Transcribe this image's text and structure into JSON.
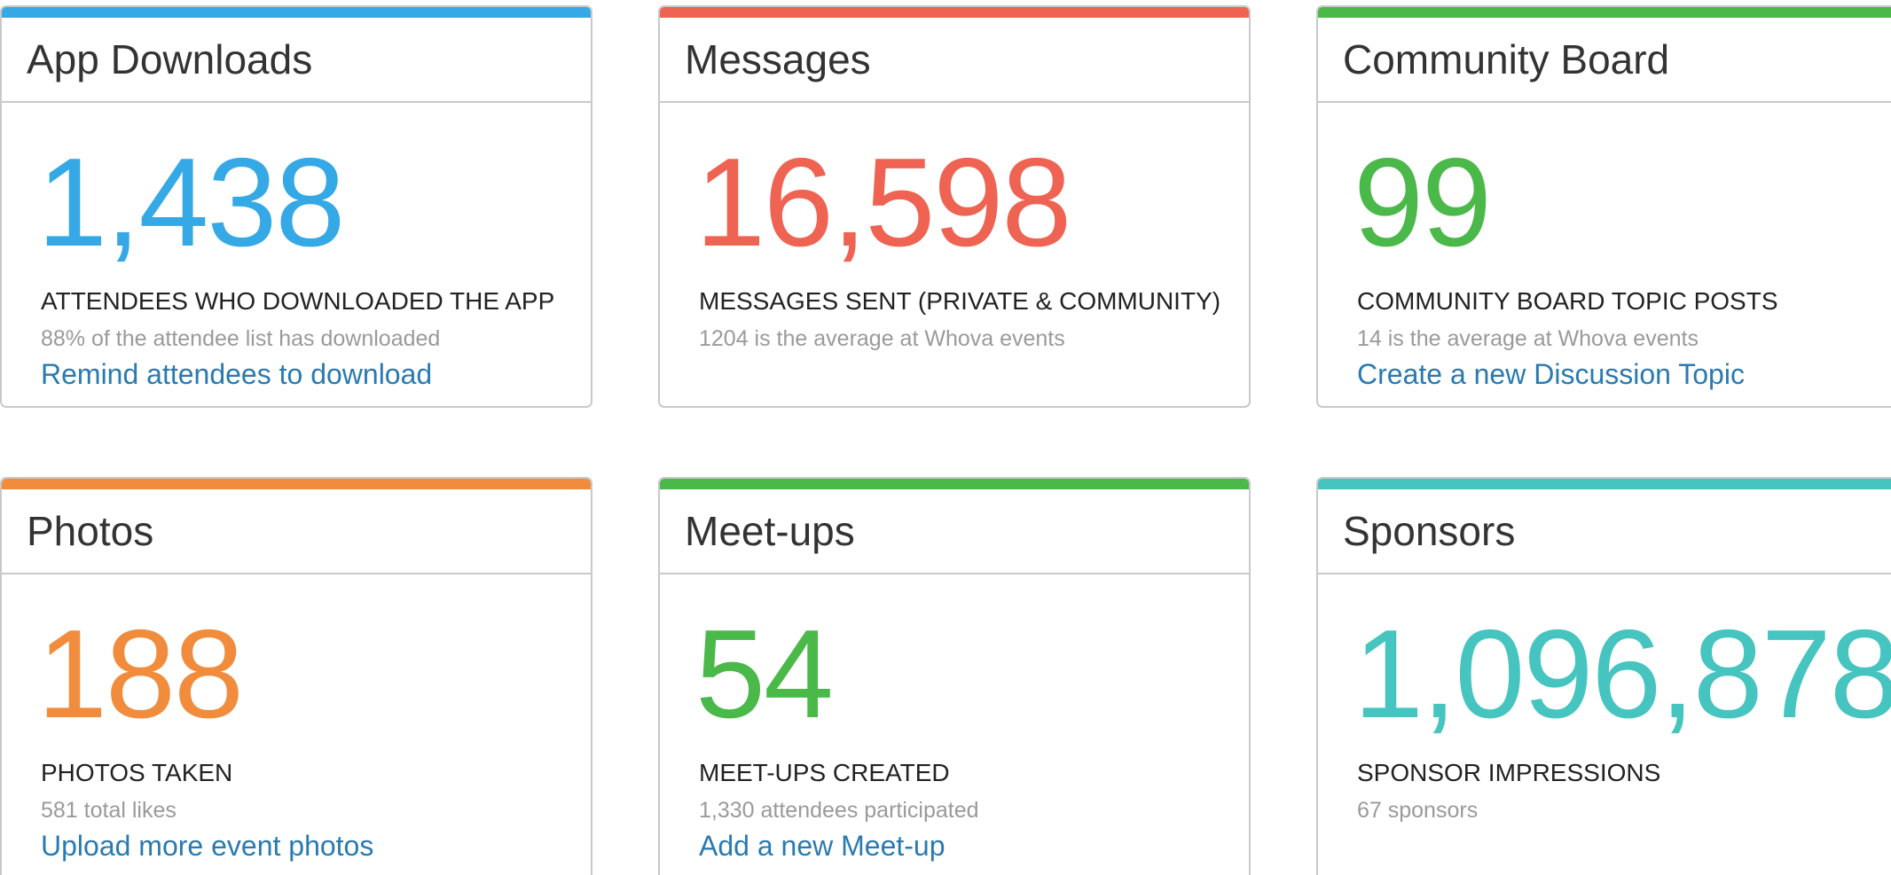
{
  "colors": {
    "blue": "#35a8e6",
    "red": "#ee6352",
    "green": "#4bb84a",
    "orange": "#f08c3c",
    "teal": "#45c4c0",
    "link": "#2a7ab0"
  },
  "cards": [
    {
      "title": "App Downloads",
      "metric": "1,438",
      "label": "ATTENDEES WHO DOWNLOADED THE APP",
      "sub": "88% of the attendee list has downloaded",
      "link": "Remind attendees to download"
    },
    {
      "title": "Messages",
      "metric": "16,598",
      "label": "MESSAGES SENT (PRIVATE & COMMUNITY)",
      "sub": "1204 is the average at Whova events",
      "link": ""
    },
    {
      "title": "Community Board",
      "metric": "99",
      "label": "COMMUNITY BOARD TOPIC POSTS",
      "sub": "14 is the average at Whova events",
      "link": "Create a new Discussion Topic"
    },
    {
      "title": "Photos",
      "metric": "188",
      "label": "PHOTOS TAKEN",
      "sub": "581 total likes",
      "link": "Upload more event photos"
    },
    {
      "title": "Meet-ups",
      "metric": "54",
      "label": "MEET-UPS CREATED",
      "sub": "1,330 attendees participated",
      "link": "Add a new Meet-up"
    },
    {
      "title": "Sponsors",
      "metric": "1,096,878",
      "label": "SPONSOR IMPRESSIONS",
      "sub": "67 sponsors",
      "link": ""
    }
  ]
}
